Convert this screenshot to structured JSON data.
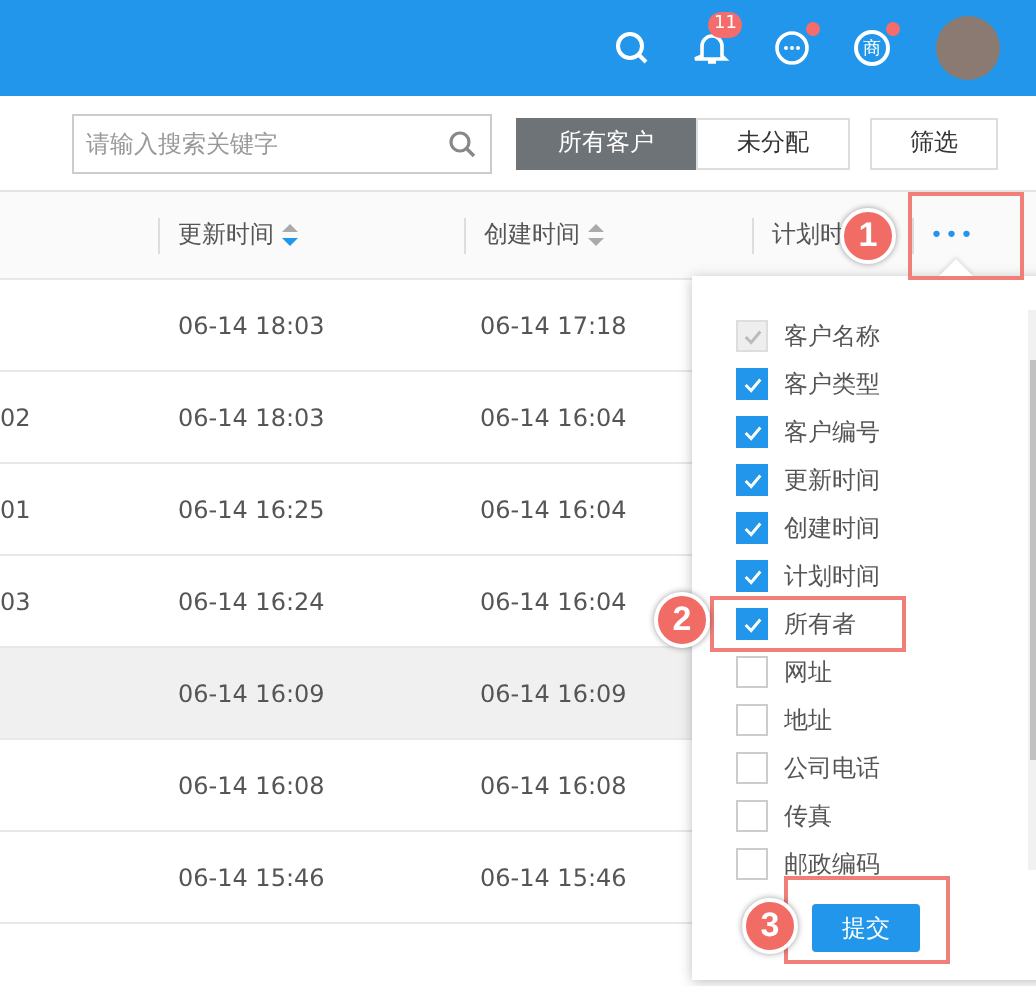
{
  "header": {
    "notification_count": "11",
    "chat_unread": true,
    "shop_label": "商",
    "shop_unread": true
  },
  "toolbar": {
    "search": {
      "placeholder": "请输入搜索关键字"
    },
    "tabs": [
      {
        "label": "所有客户",
        "selected": true
      },
      {
        "label": "未分配",
        "selected": false
      }
    ],
    "filter_button": "筛选"
  },
  "table": {
    "columns": [
      {
        "label": "更新时间",
        "sorted": true
      },
      {
        "label": "创建时间",
        "sorted": false
      },
      {
        "label": "计划时"
      }
    ],
    "more_button": "•••",
    "rows": [
      {
        "updated": "06-14 18:03",
        "created": "06-14 17:18",
        "highlighted": false
      },
      {
        "column_1": "02",
        "updated": "06-14 18:03",
        "created": "06-14 16:04",
        "highlighted": false
      },
      {
        "column_1": "01",
        "updated": "06-14 16:25",
        "created": "06-14 16:04",
        "highlighted": false
      },
      {
        "column_1": "03",
        "updated": "06-14 16:24",
        "created": "06-14 16:04",
        "highlighted": false
      },
      {
        "updated": "06-14 16:09",
        "created": "06-14 16:09",
        "highlighted": true
      },
      {
        "updated": "06-14 16:08",
        "created": "06-14 16:08",
        "highlighted": false
      },
      {
        "updated": "06-14 15:46",
        "created": "06-14 15:46",
        "highlighted": false
      }
    ]
  },
  "column_menu": {
    "items": [
      {
        "label": "客户名称",
        "checked": true,
        "disabled": true
      },
      {
        "label": "客户类型",
        "checked": true,
        "disabled": false
      },
      {
        "label": "客户编号",
        "checked": true,
        "disabled": false
      },
      {
        "label": "更新时间",
        "checked": true,
        "disabled": false
      },
      {
        "label": "创建时间",
        "checked": true,
        "disabled": false
      },
      {
        "label": "计划时间",
        "checked": true,
        "disabled": false
      },
      {
        "label": "所有者",
        "checked": true,
        "disabled": false
      },
      {
        "label": "网址",
        "checked": false,
        "disabled": false
      },
      {
        "label": "地址",
        "checked": false,
        "disabled": false
      },
      {
        "label": "公司电话",
        "checked": false,
        "disabled": false
      },
      {
        "label": "传真",
        "checked": false,
        "disabled": false
      },
      {
        "label": "邮政编码",
        "checked": false,
        "disabled": false
      }
    ],
    "submit": "提交"
  },
  "annotations": [
    {
      "number": "1"
    },
    {
      "number": "2"
    },
    {
      "number": "3"
    }
  ]
}
